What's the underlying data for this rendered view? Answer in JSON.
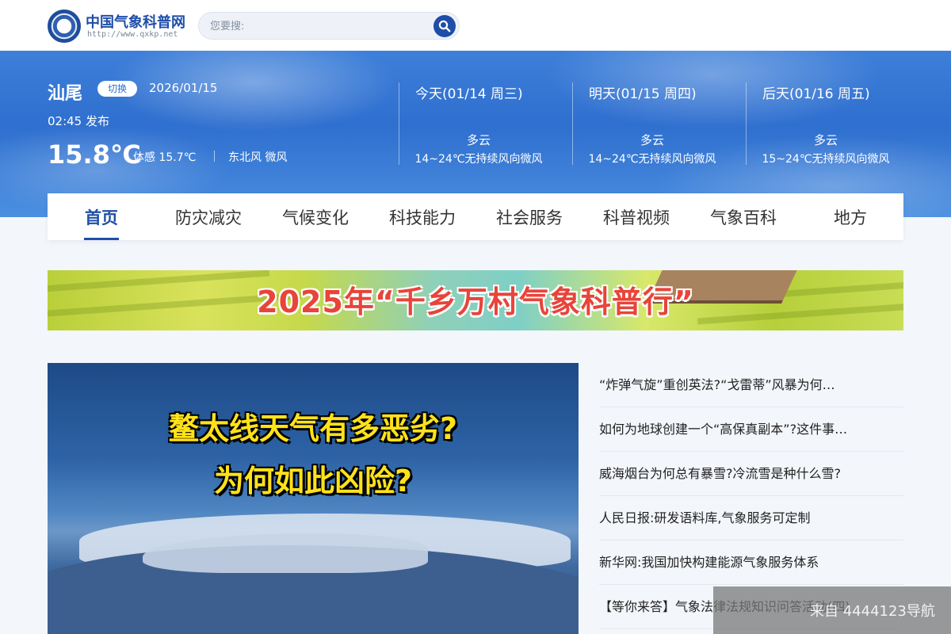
{
  "site": {
    "name": "中国气象科普网",
    "url": "http://www.qxkp.net"
  },
  "search": {
    "placeholder": "您要搜:"
  },
  "weather": {
    "city": "汕尾",
    "switch_label": "切换",
    "date": "2026/01/15",
    "publish": "02:45  发布",
    "temperature": "15.8℃",
    "feels_like": "体感 15.7℃",
    "wind": "东北风 微风",
    "forecast": [
      {
        "day": "今天(01/14 周三)",
        "condition": "多云",
        "range": "14~24℃无持续风向微风"
      },
      {
        "day": "明天(01/15 周四)",
        "condition": "多云",
        "range": "14~24℃无持续风向微风"
      },
      {
        "day": "后天(01/16 周五)",
        "condition": "多云",
        "range": "15~24℃无持续风向微风"
      }
    ]
  },
  "nav": {
    "items": [
      "首页",
      "防灾减灾",
      "气候变化",
      "科技能力",
      "社会服务",
      "科普视频",
      "气象百科",
      "地方"
    ],
    "active": "首页"
  },
  "banner": {
    "title": "2025年“千乡万村气象科普行”"
  },
  "feature": {
    "line1": "鳌太线天气有多恶劣?",
    "line2": "为何如此凶险?"
  },
  "news": [
    "“炸弹气旋”重创英法?“戈雷蒂”风暴为何…",
    "如何为地球创建一个“高保真副本”?这件事…",
    "威海烟台为何总有暴雪?冷流雪是种什么雪?",
    "人民日报:研发语料库,气象服务可定制",
    "新华网:我国加快构建能源气象服务体系",
    "【等你来答】气象法律法规知识问答活动(四)"
  ],
  "watermark": "来自 4444123导航",
  "colors": {
    "brand": "#1e4ea8",
    "hero": "#2f6fcf",
    "banner_title": "#e8443a",
    "feature_text": "#ffe21a"
  }
}
